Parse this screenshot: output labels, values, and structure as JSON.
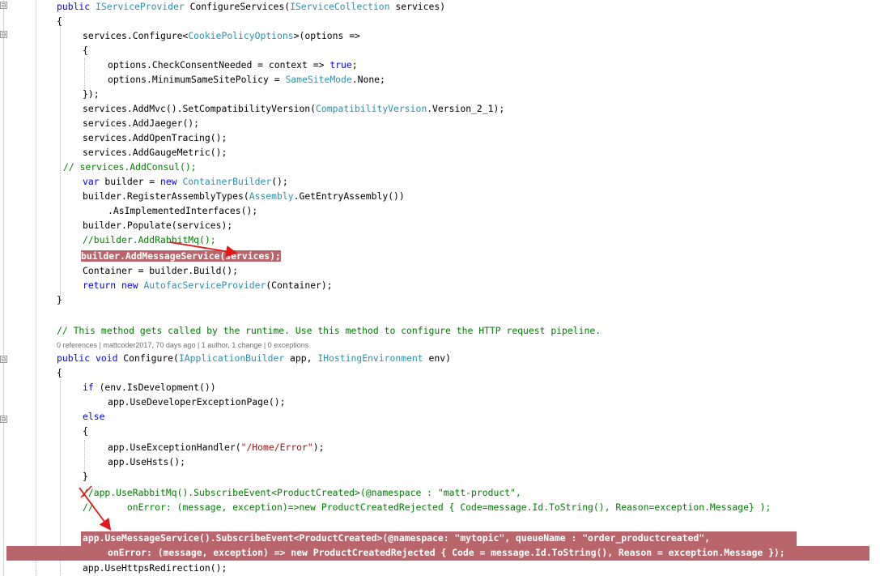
{
  "code_lines": {
    "l1": [
      "public ",
      "IServiceProvider",
      " ConfigureServices(",
      "IServiceCollection",
      " services)"
    ],
    "l2": "{",
    "l3": [
      "services.Configure<",
      "CookiePolicyOptions",
      ">(options =>"
    ],
    "l4": "{",
    "l5": [
      "options.CheckConsentNeeded = context => ",
      "true",
      ";"
    ],
    "l6": [
      "options.MinimumSameSitePolicy = ",
      "SameSiteMode",
      ".None;"
    ],
    "l7": "});",
    "l8": [
      "services.AddMvc().SetCompatibilityVersion(",
      "CompatibilityVersion",
      ".Version_2_1);"
    ],
    "l9": "services.AddJaeger();",
    "l10": "services.AddOpenTracing();",
    "l11": "services.AddGaugeMetric();",
    "l12": "// services.AddConsul();",
    "l13": [
      "var",
      " builder = ",
      "new",
      " ",
      "ContainerBuilder",
      "();"
    ],
    "l14": [
      "builder.RegisterAssemblyTypes(",
      "Assembly",
      ".GetEntryAssembly())"
    ],
    "l15": ".AsImplementedInterfaces();",
    "l16": "builder.Populate(services);",
    "l17": "//builder.AddRabbitMq();",
    "l18": "builder.AddMessageService(services);",
    "l19": "Container = builder.Build();",
    "l20": [
      "return",
      " ",
      "new",
      " ",
      "AutofacServiceProvider",
      "(Container);"
    ],
    "l21": "}",
    "l22": "// This method gets called by the runtime. Use this method to configure the HTTP request pipeline.",
    "codelens": "0 references | mattcoder2017, 70 days ago | 1 author, 1 change | 0 exceptions",
    "l23": [
      "public ",
      "void",
      " Configure(",
      "IApplicationBuilder",
      " app, ",
      "IHostingEnvironment",
      " env)"
    ],
    "l24": "{",
    "l25": [
      "if",
      " (env.IsDevelopment())"
    ],
    "l26": "app.UseDeveloperExceptionPage();",
    "l27": "else",
    "l28": "{",
    "l29": [
      "app.UseExceptionHandler(",
      "\"/Home/Error\"",
      ");"
    ],
    "l30": "app.UseHsts();",
    "l31": "}",
    "l32": "//app.UseRabbitMq().SubscribeEvent<ProductCreated>(@namespace : \"matt-product\",",
    "l33": "//      onError: (message, exception)=>new ProductCreatedRejected { Code=message.Id.ToString(), Reason=exception.Message} );",
    "l34": "app.UseMessageService().SubscribeEvent<ProductCreated>(@namespace: \"mytopic\", queueName : \"order_productcreated\",",
    "l35": "onError: (message, exception) => new ProductCreatedRejected { Code = message.Id.ToString(), Reason = exception.Message });",
    "l36": "app.UseHttpsRedirection();"
  },
  "fold_markers": [
    "⊟",
    "⊟",
    "⊟",
    "⊟"
  ],
  "colors": {
    "keyword": "#0000ff",
    "type": "#2b91af",
    "string": "#a31515",
    "comment": "#008000",
    "highlight": "#b8666c",
    "arrow": "#e01818"
  }
}
